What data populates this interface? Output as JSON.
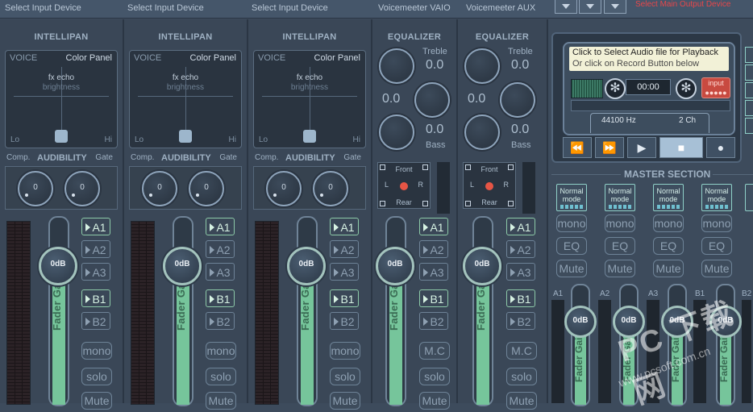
{
  "topbar": {
    "devices": [
      "Select Input Device",
      "Select Input Device",
      "Select Input Device",
      "Voicemeeter VAIO",
      "Voicemeeter AUX"
    ],
    "main_output": "Select Main Output Device"
  },
  "strips": [
    {
      "title": "INTELLIPAN",
      "voice": "VOICE",
      "color_panel": "Color Panel",
      "fx": "fx echo",
      "brightness": "brightness",
      "lo": "Lo",
      "hi": "Hi",
      "comp": "Comp.",
      "audibility": "AUDIBILITY",
      "gate": "Gate",
      "comp_val": "0",
      "gate_val": "0",
      "gain": "0dB",
      "fader_label": "Fader Gain",
      "buses": [
        "A1",
        "A2",
        "A3",
        "B1",
        "B2"
      ],
      "mono": "mono",
      "solo": "solo",
      "mute": "Mute"
    },
    {
      "title": "INTELLIPAN",
      "voice": "VOICE",
      "color_panel": "Color Panel",
      "fx": "fx echo",
      "brightness": "brightness",
      "lo": "Lo",
      "hi": "Hi",
      "comp": "Comp.",
      "audibility": "AUDIBILITY",
      "gate": "Gate",
      "comp_val": "0",
      "gate_val": "0",
      "gain": "0dB",
      "fader_label": "Fader Gain",
      "buses": [
        "A1",
        "A2",
        "A3",
        "B1",
        "B2"
      ],
      "mono": "mono",
      "solo": "solo",
      "mute": "Mute"
    },
    {
      "title": "INTELLIPAN",
      "voice": "VOICE",
      "color_panel": "Color Panel",
      "fx": "fx echo",
      "brightness": "brightness",
      "lo": "Lo",
      "hi": "Hi",
      "comp": "Comp.",
      "audibility": "AUDIBILITY",
      "gate": "Gate",
      "comp_val": "0",
      "gate_val": "0",
      "gain": "0dB",
      "fader_label": "Fader Gain",
      "buses": [
        "A1",
        "A2",
        "A3",
        "B1",
        "B2"
      ],
      "mono": "mono",
      "solo": "solo",
      "mute": "Mute"
    }
  ],
  "virtual": [
    {
      "title": "EQUALIZER",
      "treble": "Treble",
      "treble_val": "0.0",
      "mid_val": "0.0",
      "bass_val": "0.0",
      "bass": "Bass",
      "front": "Front",
      "rear": "Rear",
      "l": "L",
      "r": "R",
      "gain": "0dB",
      "fader_label": "Fader Gain",
      "buses": [
        "A1",
        "A2",
        "A3",
        "B1",
        "B2"
      ],
      "mc": "M.C",
      "solo": "solo",
      "mute": "Mute"
    },
    {
      "title": "EQUALIZER",
      "treble": "Treble",
      "treble_val": "0.0",
      "mid_val": "0.0",
      "bass_val": "0.0",
      "bass": "Bass",
      "front": "Front",
      "rear": "Rear",
      "l": "L",
      "r": "R",
      "gain": "0dB",
      "fader_label": "Fader Gain",
      "buses": [
        "A1",
        "A2",
        "A3",
        "B1",
        "B2"
      ],
      "mc": "M.C",
      "solo": "solo",
      "mute": "Mute"
    }
  ],
  "recorder": {
    "msg1": "Click to Select Audio file for Playback",
    "msg2": "Or click on Record Button below",
    "time": "00:00",
    "input_label": "input",
    "hz": "44100 Hz",
    "ch": "2 Ch",
    "transport": [
      "⏪",
      "⏩",
      "▶",
      "■",
      "●"
    ]
  },
  "master": {
    "title": "MASTER SECTION",
    "buses": [
      {
        "mode": "Normal mode",
        "mono": "mono",
        "eq": "EQ",
        "mute": "Mute",
        "name": "A1",
        "gain": "0dB",
        "fader_label": "Fader Gain"
      },
      {
        "mode": "Normal mode",
        "mono": "mono",
        "eq": "EQ",
        "mute": "Mute",
        "name": "A2",
        "gain": "0dB",
        "fader_label": "Fader Gain"
      },
      {
        "mode": "Normal mode",
        "mono": "mono",
        "eq": "EQ",
        "mute": "Mute",
        "name": "A3",
        "gain": "0dB",
        "fader_label": "Fader Gain"
      },
      {
        "mode": "Normal mode",
        "mono": "mono",
        "eq": "EQ",
        "mute": "Mute",
        "name": "B1",
        "gain": "0dB",
        "fader_label": "Fader Gain"
      }
    ],
    "b2_name": "B2"
  },
  "watermark": {
    "big": "PC 下载网",
    "small": "www.pcsoft.com.cn"
  },
  "colors": {
    "accent": "#76c59b",
    "background": "#3d4b5c",
    "record": "#c84a40"
  }
}
